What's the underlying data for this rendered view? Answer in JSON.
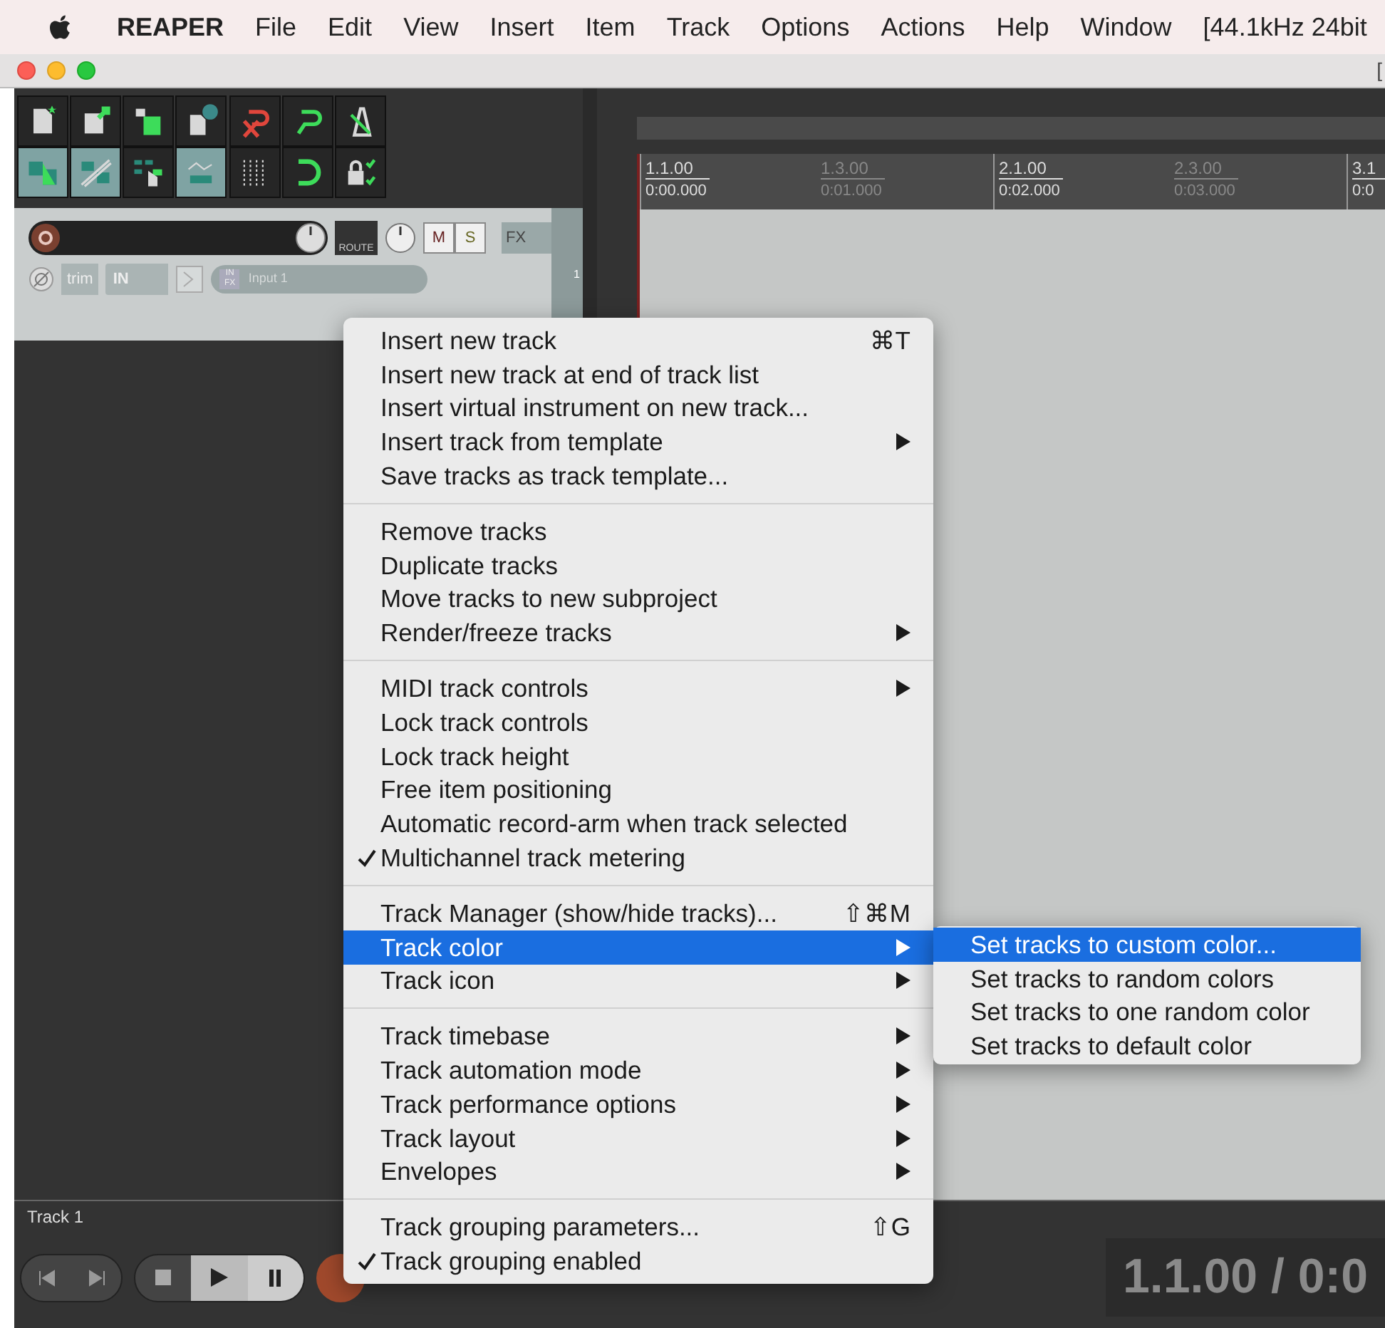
{
  "menubar": {
    "app": "REAPER",
    "items": [
      "File",
      "Edit",
      "View",
      "Insert",
      "Item",
      "Track",
      "Options",
      "Actions",
      "Help",
      "Window",
      "[44.1kHz 24bit"
    ]
  },
  "title_bar": {
    "title": "["
  },
  "track": {
    "number": "1",
    "route": "ROUTE",
    "mute": "M",
    "solo": "S",
    "fx": "FX",
    "trim": "trim",
    "input_mode": "IN",
    "input_fx": "IN FX",
    "input": "Input 1"
  },
  "ruler": [
    {
      "bar": "1.1.00",
      "time": "0:00.000",
      "kind": "major"
    },
    {
      "bar": "1.3.00",
      "time": "0:01.000",
      "kind": "minor"
    },
    {
      "bar": "2.1.00",
      "time": "0:02.000",
      "kind": "major"
    },
    {
      "bar": "2.3.00",
      "time": "0:03.000",
      "kind": "minor"
    },
    {
      "bar": "3.1",
      "time": "0:0",
      "kind": "major"
    }
  ],
  "bottom": {
    "track_label": "Track 1",
    "time_display": "1.1.00 / 0:0"
  },
  "context_menu": [
    [
      {
        "label": "Insert new track",
        "shortcut": "⌘T",
        "submenu": false,
        "checked": false,
        "selected": false
      },
      {
        "label": "Insert new track at end of track list",
        "submenu": false,
        "checked": false,
        "selected": false
      },
      {
        "label": "Insert virtual instrument on new track...",
        "submenu": false,
        "checked": false,
        "selected": false
      },
      {
        "label": "Insert track from template",
        "submenu": true,
        "checked": false,
        "selected": false
      },
      {
        "label": "Save tracks as track template...",
        "submenu": false,
        "checked": false,
        "selected": false
      }
    ],
    [
      {
        "label": "Remove tracks",
        "submenu": false,
        "checked": false,
        "selected": false
      },
      {
        "label": "Duplicate tracks",
        "submenu": false,
        "checked": false,
        "selected": false
      },
      {
        "label": "Move tracks to new subproject",
        "submenu": false,
        "checked": false,
        "selected": false
      },
      {
        "label": "Render/freeze tracks",
        "submenu": true,
        "checked": false,
        "selected": false
      }
    ],
    [
      {
        "label": "MIDI track controls",
        "submenu": true,
        "checked": false,
        "selected": false
      },
      {
        "label": "Lock track controls",
        "submenu": false,
        "checked": false,
        "selected": false
      },
      {
        "label": "Lock track height",
        "submenu": false,
        "checked": false,
        "selected": false
      },
      {
        "label": "Free item positioning",
        "submenu": false,
        "checked": false,
        "selected": false
      },
      {
        "label": "Automatic record-arm when track selected",
        "submenu": false,
        "checked": false,
        "selected": false
      },
      {
        "label": "Multichannel track metering",
        "submenu": false,
        "checked": true,
        "selected": false
      }
    ],
    [
      {
        "label": "Track Manager (show/hide tracks)...",
        "shortcut": "⇧⌘M",
        "submenu": false,
        "checked": false,
        "selected": false
      },
      {
        "label": "Track color",
        "submenu": true,
        "checked": false,
        "selected": true
      },
      {
        "label": "Track icon",
        "submenu": true,
        "checked": false,
        "selected": false
      }
    ],
    [
      {
        "label": "Track timebase",
        "submenu": true,
        "checked": false,
        "selected": false
      },
      {
        "label": "Track automation mode",
        "submenu": true,
        "checked": false,
        "selected": false
      },
      {
        "label": "Track performance options",
        "submenu": true,
        "checked": false,
        "selected": false
      },
      {
        "label": "Track layout",
        "submenu": true,
        "checked": false,
        "selected": false
      },
      {
        "label": "Envelopes",
        "submenu": true,
        "checked": false,
        "selected": false
      }
    ],
    [
      {
        "label": "Track grouping parameters...",
        "shortcut": "⇧G",
        "submenu": false,
        "checked": false,
        "selected": false
      },
      {
        "label": "Track grouping enabled",
        "submenu": false,
        "checked": true,
        "selected": false
      }
    ]
  ],
  "submenu": [
    {
      "label": "Set tracks to custom color...",
      "selected": true
    },
    {
      "label": "Set tracks to random colors",
      "selected": false
    },
    {
      "label": "Set tracks to one random color",
      "selected": false
    },
    {
      "label": "Set tracks to default color",
      "selected": false
    }
  ]
}
